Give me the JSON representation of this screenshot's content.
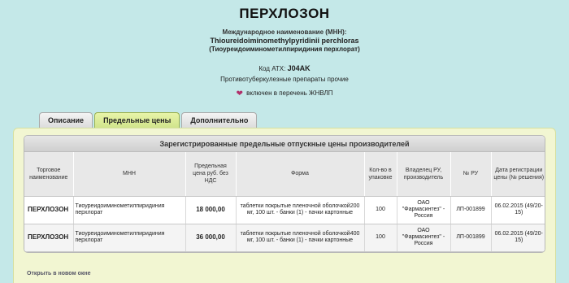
{
  "header": {
    "title": "ПЕРХЛОЗОН",
    "inn_caption": "Международное наименование (МНН):",
    "inn_latin": "Thioureidoiminomethylpyridinii perchloras",
    "inn_ru": "(Тиоуреидоиминометилпиридиния перхлорат)",
    "atc_label": "Код АТХ:",
    "atc_code": "J04AK",
    "atc_desc": "Противотуберкулезные препараты прочие",
    "jnvlp_text": "включен в перечень ЖНВЛП"
  },
  "tabs": [
    {
      "label": "Описание",
      "active": false
    },
    {
      "label": "Предельные цены",
      "active": true
    },
    {
      "label": "Дополнительно",
      "active": false
    }
  ],
  "price_table": {
    "caption": "Зарегистрированные предельные отпускные цены производителей",
    "columns": [
      "Торговое наименование",
      "МНН",
      "Предельная цена руб. без НДС",
      "Форма",
      "Кол-во в упаковке",
      "Владелец РУ, производитель",
      "№ РУ",
      "Дата регистрации цены (№ решения)"
    ],
    "rows": [
      {
        "name": "ПЕРХЛОЗОН",
        "inn": "Тиоуреидоиминометилпиридиния перхлорат",
        "price": "18 000,00",
        "form": "таблетки покрытые пленочной оболочкой200 мг, 100 шт. - банки (1) - пачки картонные",
        "qty": "100",
        "owner": "ОАО \"Фармасинтез\" - Россия",
        "reg_no": "ЛП-001899",
        "reg_date": "06.02.2015 (49/20-15)"
      },
      {
        "name": "ПЕРХЛОЗОН",
        "inn": "Тиоуреидоиминометилпиридиния перхлорат",
        "price": "36 000,00",
        "form": "таблетки покрытые пленочной оболочкой400 мг, 100 шт. - банки (1) - пачки картонные",
        "qty": "100",
        "owner": "ОАО \"Фармасинтез\" - Россия",
        "reg_no": "ЛП-001899",
        "reg_date": "06.02.2015 (49/20-15)"
      }
    ]
  },
  "open_link": "Открыть в новом окне",
  "icons": {
    "jnvlp": "heart-icon"
  },
  "colors": {
    "background": "#c4e8e8",
    "active_tab": "#cfe38a",
    "panel": "#f2f6d2"
  }
}
